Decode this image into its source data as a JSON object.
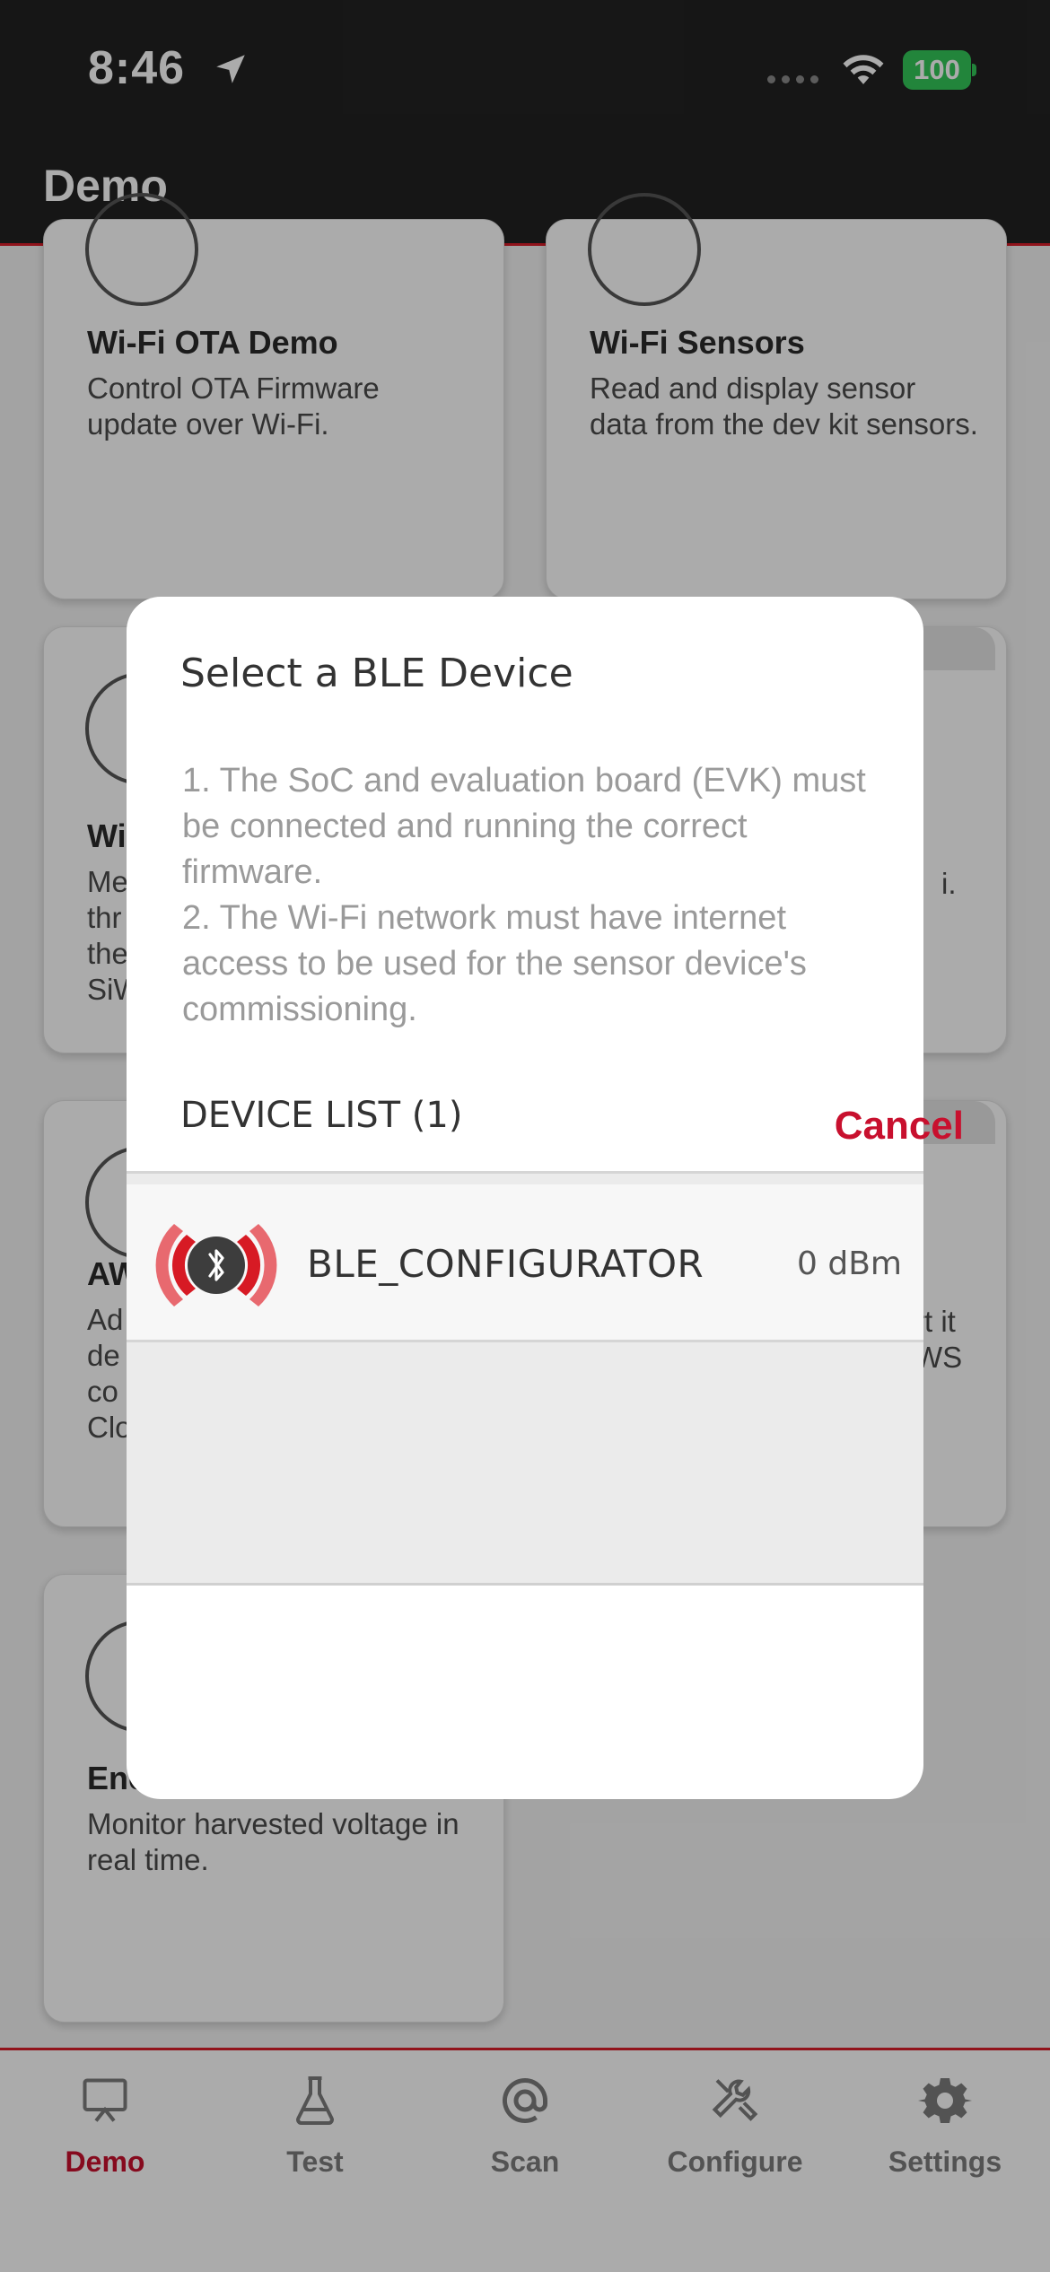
{
  "status_bar": {
    "time": "8:46",
    "battery": "100",
    "battery_color": "#34c759"
  },
  "header": {
    "title": "Demo"
  },
  "cards": [
    {
      "title": "Wi-Fi OTA Demo",
      "description": "Control OTA Firmware update over Wi-Fi.",
      "icon": "download-cloud-icon"
    },
    {
      "title": "Wi-Fi Sensors",
      "description": "Read and display sensor data from the dev kit sensors.",
      "icon": "wifi-icon"
    },
    {
      "title": "Wi",
      "description": "Me thr the SiW",
      "icon": "wifi-icon"
    },
    {
      "title": "",
      "description": "i.",
      "icon": ""
    },
    {
      "title": "AW",
      "description": "Ad de co Clo",
      "icon": "aws-icon"
    },
    {
      "title": "",
      "description": "rt it WS",
      "icon": ""
    },
    {
      "title": "Energy",
      "description": "Monitor harvested voltage in real time.",
      "icon": "energy-icon"
    }
  ],
  "modal": {
    "title": "Select a BLE Device",
    "message": "1. The SoC and evaluation board (EVK) must be connected and running the correct firmware.\n2. The Wi-Fi network must have internet access to be used for the sensor device's commissioning.",
    "list_header": "DEVICE LIST (1)",
    "devices": [
      {
        "name": "BLE_CONFIGURATOR",
        "rssi": "0 dBm",
        "icon": "bluetooth-signal-icon"
      }
    ],
    "cancel_label": "Cancel"
  },
  "tabs": [
    {
      "label": "Demo",
      "icon": "presentation-board-icon",
      "active": true
    },
    {
      "label": "Test",
      "icon": "flask-icon",
      "active": false
    },
    {
      "label": "Scan",
      "icon": "at-scan-icon",
      "active": false
    },
    {
      "label": "Configure",
      "icon": "tools-icon",
      "active": false
    },
    {
      "label": "Settings",
      "icon": "gear-icon",
      "active": false
    }
  ],
  "colors": {
    "accent": "#c8102e",
    "header_bg": "#222222"
  }
}
